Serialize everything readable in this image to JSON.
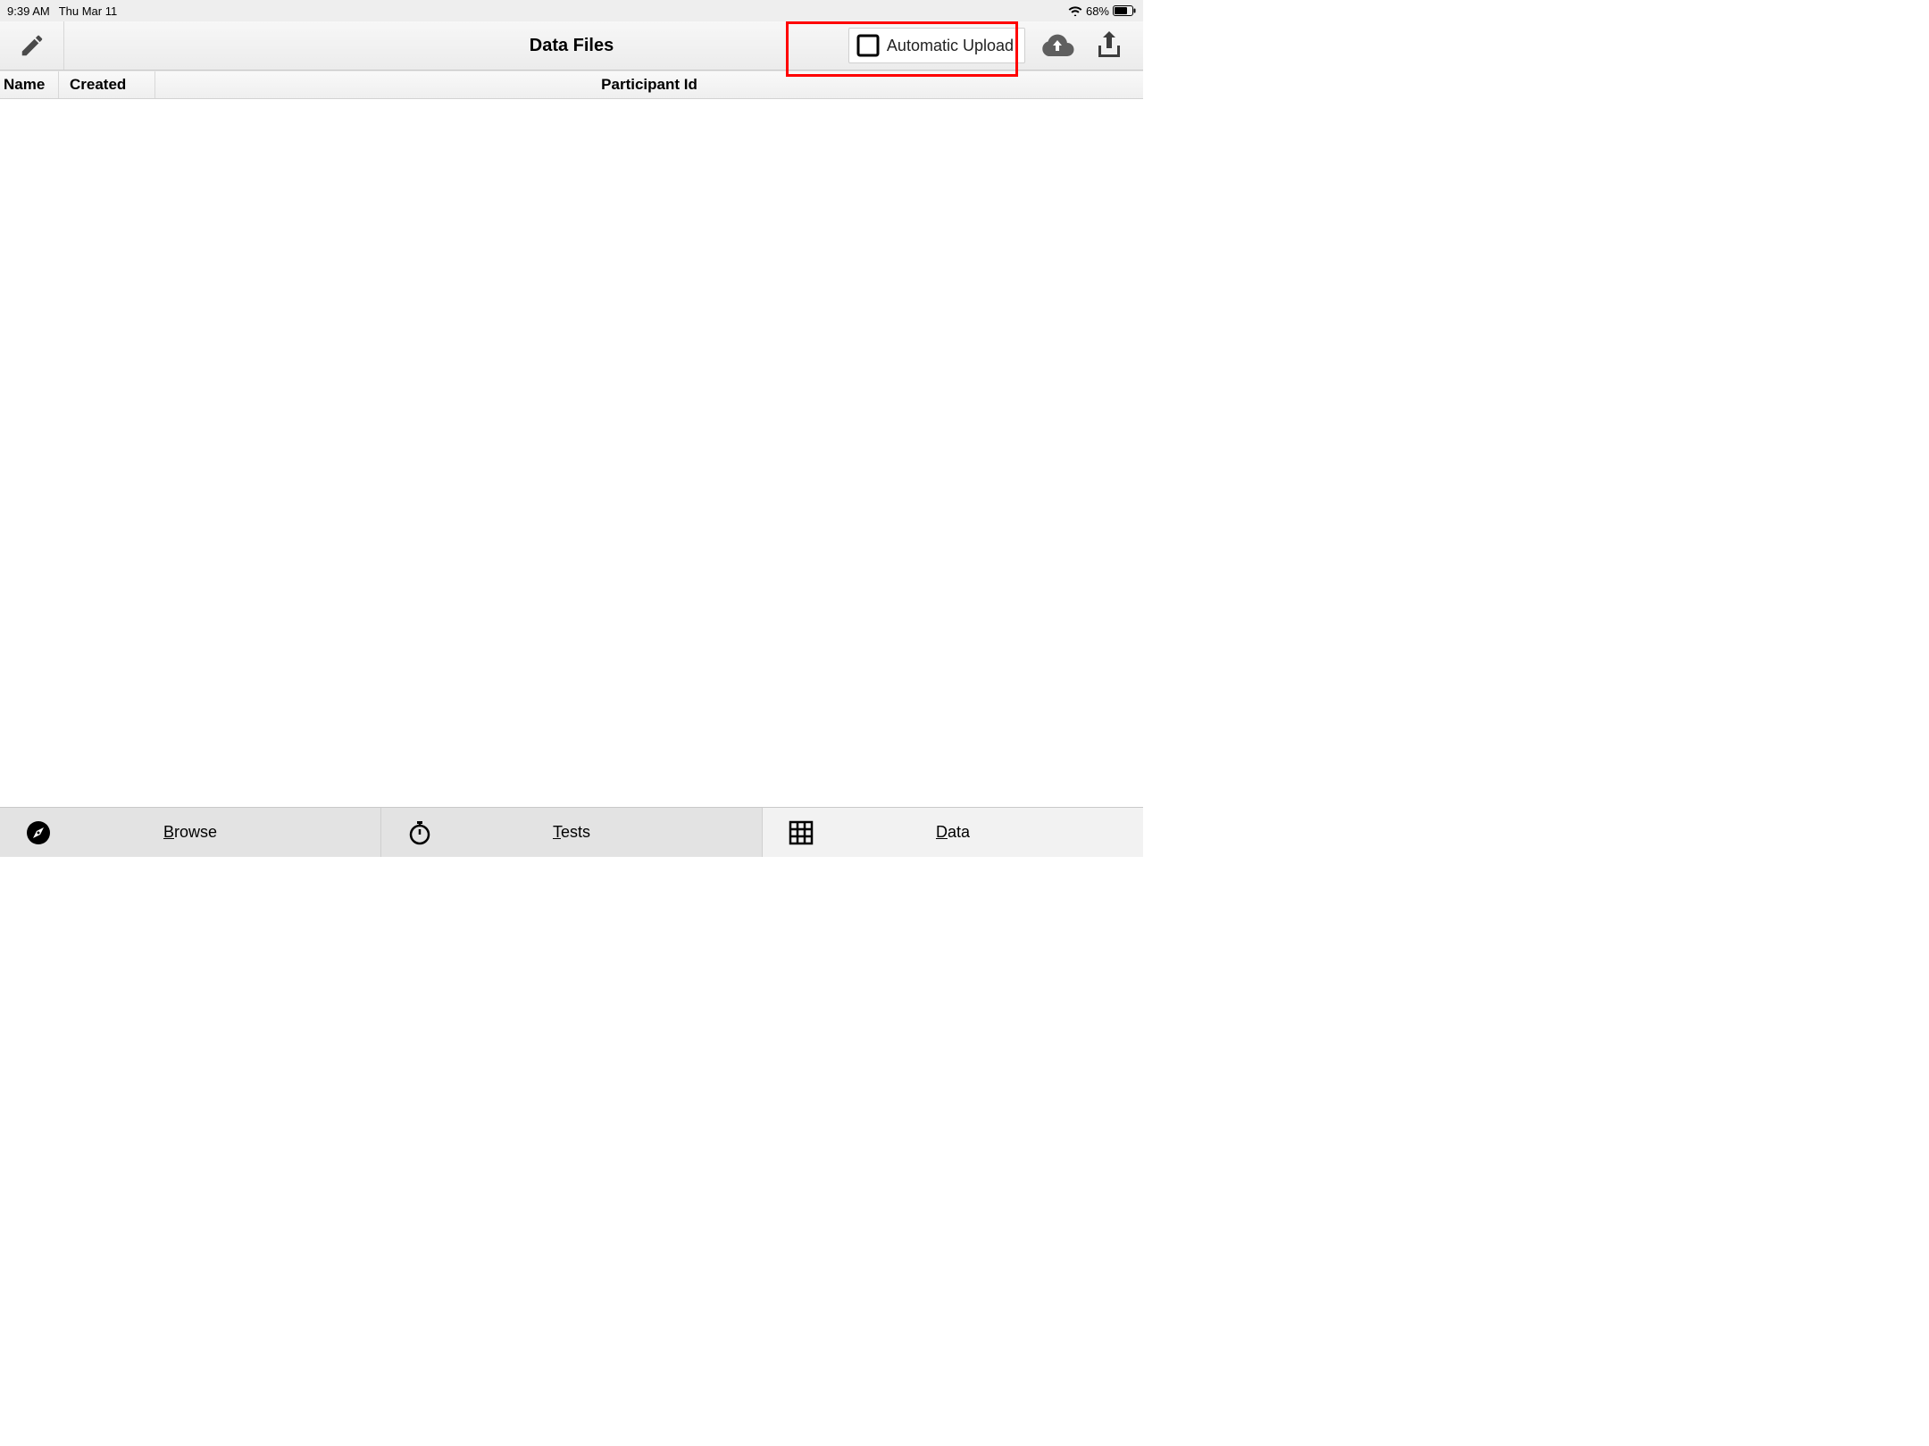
{
  "status": {
    "time": "9:39 AM",
    "date": "Thu Mar 11",
    "battery_pct": "68%"
  },
  "toolbar": {
    "title": "Data Files",
    "auto_upload_label": "Automatic Upload"
  },
  "columns": {
    "name": "Name",
    "created": "Created",
    "participant": "Participant Id"
  },
  "tabs": {
    "browse": "Browse",
    "tests": "Tests",
    "data": "Data"
  }
}
